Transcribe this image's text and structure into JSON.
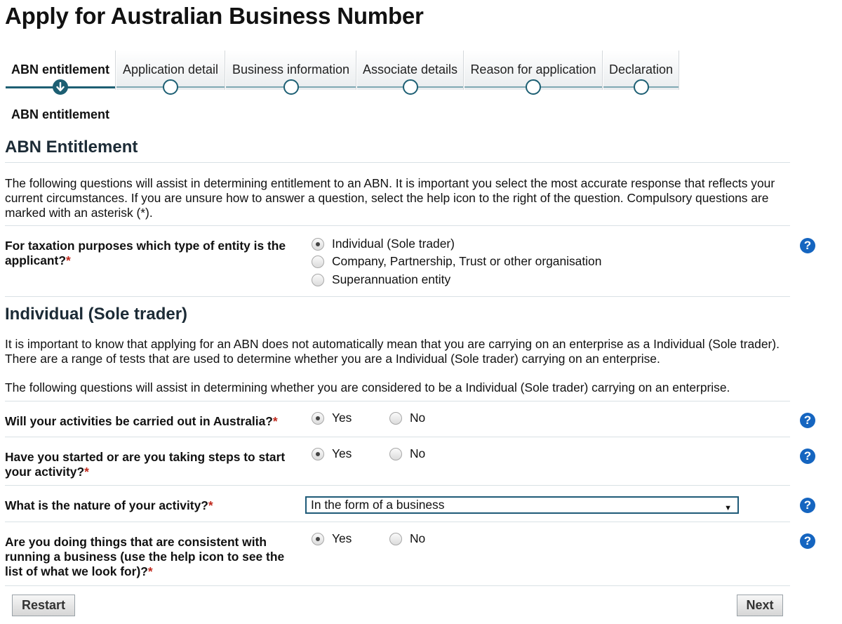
{
  "page": {
    "title": "Apply for Australian Business Number"
  },
  "steps": [
    {
      "label": "ABN entitlement",
      "active": true
    },
    {
      "label": "Application detail",
      "active": false
    },
    {
      "label": "Business information",
      "active": false
    },
    {
      "label": "Associate details",
      "active": false
    },
    {
      "label": "Reason for application",
      "active": false
    },
    {
      "label": "Declaration",
      "active": false
    }
  ],
  "current_step_label": "ABN entitlement",
  "section1": {
    "heading": "ABN Entitlement",
    "intro": "The following questions will assist in determining entitlement to an ABN. It is important you select the most accurate response that reflects your current circumstances. If you are unsure how to answer a question, select the help icon to the right of the question. Compulsory questions are marked with an asterisk (*).",
    "entity_question": {
      "label": "For taxation purposes which type of entity is the applicant?",
      "required_mark": "*",
      "options": [
        {
          "label": "Individual (Sole trader)",
          "selected": true
        },
        {
          "label": "Company, Partnership, Trust or other organisation",
          "selected": false
        },
        {
          "label": "Superannuation entity",
          "selected": false
        }
      ]
    }
  },
  "section2": {
    "heading": "Individual (Sole trader)",
    "para1": "It is important to know that applying for an ABN does not automatically mean that you are carrying on an enterprise as a Individual (Sole trader). There are a range of tests that are used to determine whether you are a Individual (Sole trader) carrying on an enterprise.",
    "para2": "The following questions will assist in determining whether you are considered to be a Individual (Sole trader) carrying on an enterprise.",
    "q_australia": {
      "label": "Will your activities be carried out in Australia?",
      "required_mark": "*",
      "yes": "Yes",
      "no": "No",
      "selected": "Yes"
    },
    "q_started": {
      "label": "Have you started or are you taking steps to start your activity?",
      "required_mark": "*",
      "yes": "Yes",
      "no": "No",
      "selected": "Yes"
    },
    "q_nature": {
      "label": "What is the nature of your activity?",
      "required_mark": "*",
      "value": "In the form of a business"
    },
    "q_consistent": {
      "label": "Are you doing things that are consistent with running a business (use the help icon to see the list of what we look for)?",
      "required_mark": "*",
      "yes": "Yes",
      "no": "No",
      "selected": "Yes"
    }
  },
  "help_icon_glyph": "?",
  "buttons": {
    "restart": "Restart",
    "next": "Next"
  },
  "colors": {
    "tracker_active": "#1d5f73",
    "help_icon": "#1565c0",
    "required": "#c0281c"
  }
}
